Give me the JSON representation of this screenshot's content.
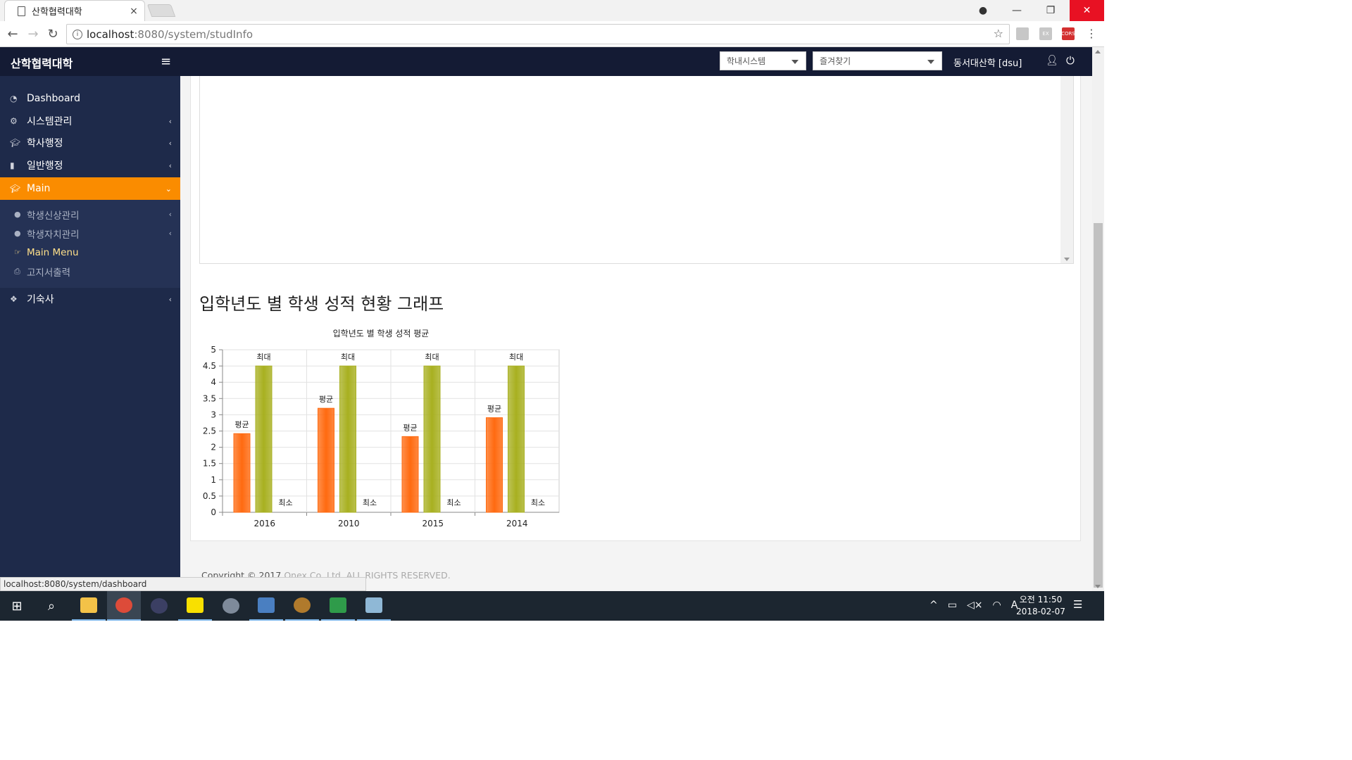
{
  "browser": {
    "tab_title": "산학협력대학",
    "tab_close": "×",
    "url_host": "localhost",
    "url_path": ":8080/system/studInfo",
    "status_url": "localhost:8080/system/dashboard",
    "ext_labels": [
      "",
      "EX",
      "CORS"
    ]
  },
  "header": {
    "brand": "산학협력대학",
    "select1": "학내시스템",
    "select2": "즐겨찾기",
    "user": "동서대산학 [dsu]"
  },
  "sidebar": {
    "items": [
      {
        "label": "Dashboard",
        "icon": "dashboard-icon"
      },
      {
        "label": "시스템관리",
        "icon": "cogs-icon"
      },
      {
        "label": "학사행정",
        "icon": "graduation-cap-icon"
      },
      {
        "label": "일반행정",
        "icon": "building-icon"
      },
      {
        "label": "Main",
        "icon": "graduation-cap-icon"
      },
      {
        "label": "기숙사",
        "icon": "cubes-icon"
      }
    ],
    "sub": [
      {
        "label": "학생신상관리",
        "icon": "user-icon"
      },
      {
        "label": "학생자치관리",
        "icon": "user-icon"
      },
      {
        "label": "Main Menu",
        "icon": "hand-point-icon"
      },
      {
        "label": "고지서출력",
        "icon": "print-icon"
      }
    ]
  },
  "main": {
    "section_title": "입학년도 별 학생 성적 현황 그래프"
  },
  "chart_data": {
    "type": "bar",
    "title": "입학년도 별 학생 성적 평균",
    "categories": [
      "2016",
      "2010",
      "2015",
      "2014"
    ],
    "series": [
      {
        "name": "평균",
        "values": [
          2.42,
          3.2,
          2.33,
          2.91
        ],
        "color": "#ff6a10"
      },
      {
        "name": "최대",
        "values": [
          4.5,
          4.5,
          4.5,
          4.5
        ],
        "color": "#a8b020"
      },
      {
        "name": "최소",
        "values": [
          0,
          0,
          0,
          0
        ],
        "color": "#888888"
      }
    ],
    "ylim": [
      0,
      5
    ],
    "yticks": [
      "0",
      "0.5",
      "1",
      "1.5",
      "2",
      "2.5",
      "3",
      "3.5",
      "4",
      "4.5",
      "5"
    ],
    "grid": true
  },
  "footer": {
    "copyright": "Copyright © 2017",
    "company": "Onex Co.,Ltd. ALL RIGHTS RESERVED."
  },
  "taskbar": {
    "time": "오전 11:50",
    "date": "2018-02-07"
  },
  "colors": {
    "header_bg": "#141b34",
    "sidebar_bg": "#1e2a4a",
    "active_item": "#fa8c00",
    "close_button": "#e81123"
  }
}
